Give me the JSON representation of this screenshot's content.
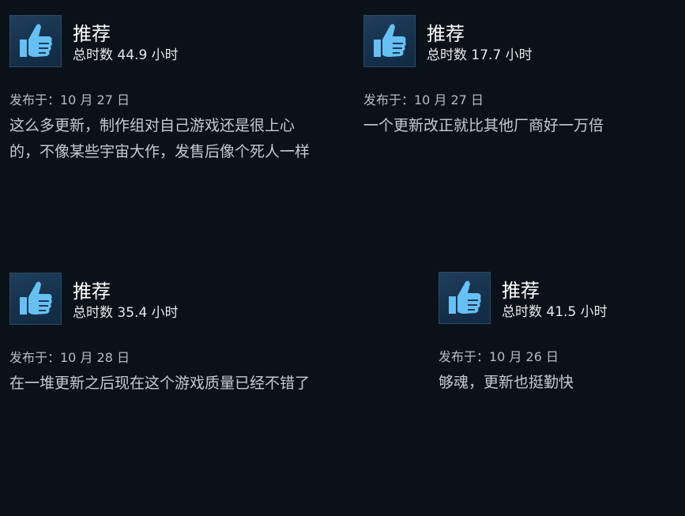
{
  "colors": {
    "background": "#0b1119",
    "icon_box": "#1b3a56",
    "thumb": "#66c0f4"
  },
  "reviews": [
    {
      "verdict": "推荐",
      "hours": "总时数 44.9 小时",
      "posted": "发布于：10 月 27 日",
      "body_lines": [
        "这么多更新，制作组对自己游戏还是很上心",
        "的，不像某些宇宙大作，发售后像个死人一样"
      ],
      "icon": "thumbs-up-icon"
    },
    {
      "verdict": "推荐",
      "hours": "总时数 17.7 小时",
      "posted": "发布于：10 月 27 日",
      "body_lines": [
        "一个更新改正就比其他厂商好一万倍"
      ],
      "icon": "thumbs-up-icon"
    },
    {
      "verdict": "推荐",
      "hours": "总时数 35.4 小时",
      "posted": "发布于：10 月 28 日",
      "body_lines": [
        "在一堆更新之后现在这个游戏质量已经不错了"
      ],
      "icon": "thumbs-up-icon"
    },
    {
      "verdict": "推荐",
      "hours": "总时数 41.5 小时",
      "posted": "发布于：10 月 26 日",
      "body_lines": [
        "够魂，更新也挺勤快"
      ],
      "icon": "thumbs-up-icon"
    }
  ]
}
